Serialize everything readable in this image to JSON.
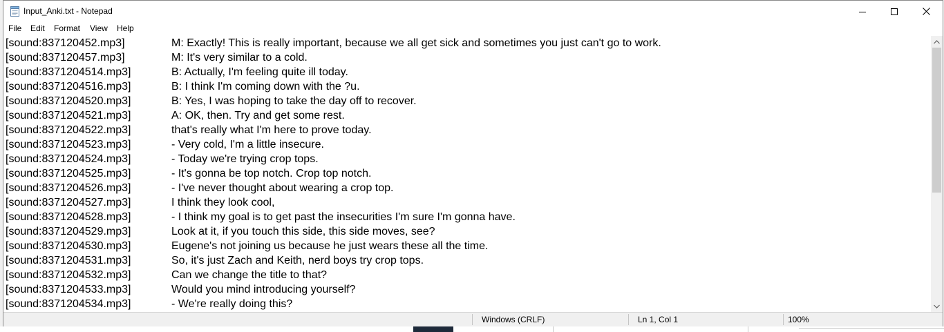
{
  "window": {
    "title": "Input_Anki.txt - Notepad",
    "icons": {
      "app": "notepad-icon",
      "minimize": "minimize-icon",
      "maximize": "maximize-icon",
      "close": "close-icon"
    }
  },
  "menu": {
    "items": [
      {
        "label": "File"
      },
      {
        "label": "Edit"
      },
      {
        "label": "Format"
      },
      {
        "label": "View"
      },
      {
        "label": "Help"
      }
    ]
  },
  "editor": {
    "lines": [
      {
        "sound": "[sound:837120452.mp3]",
        "text": "M: Exactly! This is really important, because we all get sick and sometimes you just can't go to work."
      },
      {
        "sound": "[sound:837120457.mp3]",
        "text": "M: It's very similar to a cold."
      },
      {
        "sound": "[sound:8371204514.mp3]",
        "text": "B: Actually, I'm feeling quite ill today."
      },
      {
        "sound": "[sound:8371204516.mp3]",
        "text": "B: I think I'm coming down with the ?u."
      },
      {
        "sound": "[sound:8371204520.mp3]",
        "text": "B: Yes, I was hoping to take the day off to recover."
      },
      {
        "sound": "[sound:8371204521.mp3]",
        "text": "A: OK, then. Try and get some rest."
      },
      {
        "sound": "[sound:8371204522.mp3]",
        "text": "that's really what I'm here to prove today."
      },
      {
        "sound": "[sound:8371204523.mp3]",
        "text": "- Very cold, I'm a little insecure."
      },
      {
        "sound": "[sound:8371204524.mp3]",
        "text": "- Today we're trying crop tops."
      },
      {
        "sound": "[sound:8371204525.mp3]",
        "text": "- It's gonna be top notch. Crop top notch."
      },
      {
        "sound": "[sound:8371204526.mp3]",
        "text": "- I've never thought about wearing a crop top."
      },
      {
        "sound": "[sound:8371204527.mp3]",
        "text": "I think they look cool,"
      },
      {
        "sound": "[sound:8371204528.mp3]",
        "text": "- I think my goal is to get past the insecurities I'm sure I'm gonna have."
      },
      {
        "sound": "[sound:8371204529.mp3]",
        "text": "Look at it, if you touch this side, this side moves, see?"
      },
      {
        "sound": "[sound:8371204530.mp3]",
        "text": "Eugene's not joining us because he just wears these all the time."
      },
      {
        "sound": "[sound:8371204531.mp3]",
        "text": "So, it's just Zach and Keith, nerd boys try crop tops."
      },
      {
        "sound": "[sound:8371204532.mp3]",
        "text": "Can we change the title to that?"
      },
      {
        "sound": "[sound:8371204533.mp3]",
        "text": "Would you mind introducing yourself?"
      },
      {
        "sound": "[sound:8371204534.mp3]",
        "text": "- We're really doing this?"
      }
    ]
  },
  "statusbar": {
    "line_ending": "Windows (CRLF)",
    "position": "Ln 1, Col 1",
    "zoom": "100%"
  },
  "scrollbar": {
    "arrows": {
      "up": "scroll-up-arrow-icon",
      "down": "scroll-down-arrow-icon"
    }
  }
}
